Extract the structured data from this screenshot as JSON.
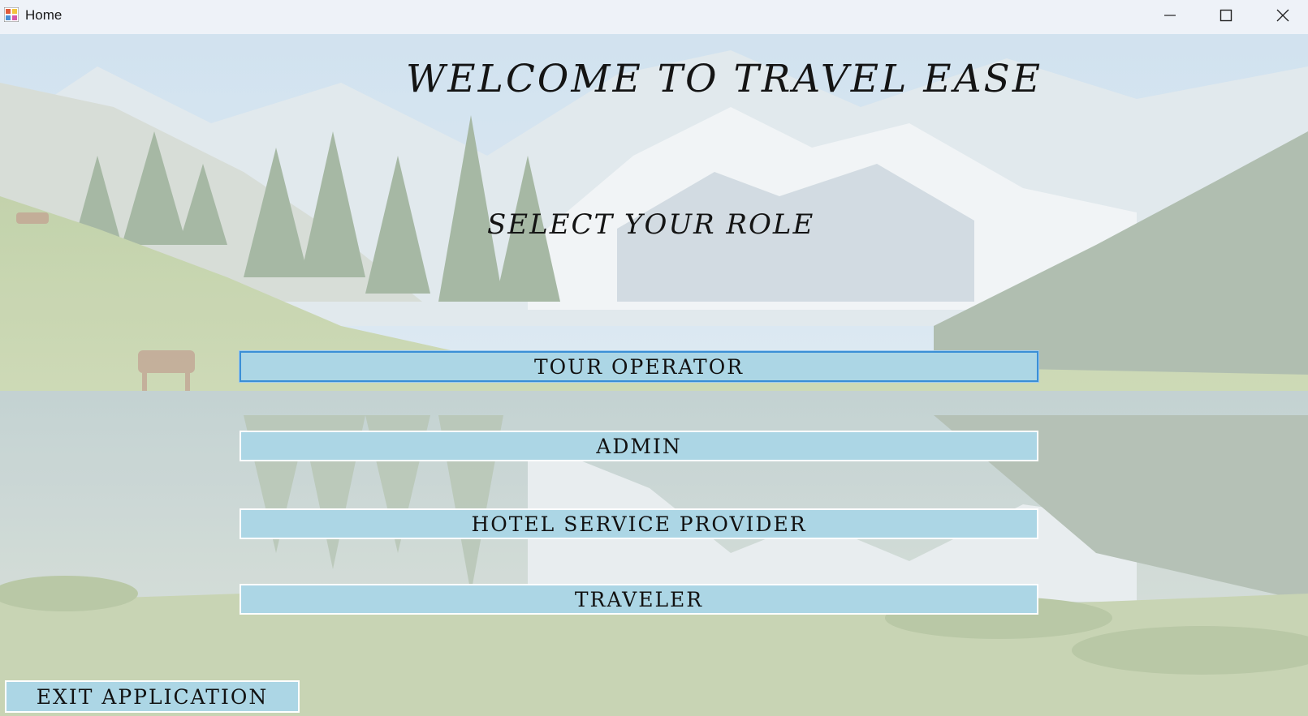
{
  "window": {
    "title": "Home"
  },
  "header": {
    "welcome": "WELCOME TO TRAVEL EASE",
    "subtitle": "SELECT YOUR ROLE"
  },
  "roles": [
    {
      "label": "TOUR OPERATOR"
    },
    {
      "label": "ADMIN"
    },
    {
      "label": "HOTEL SERVICE PROVIDER"
    },
    {
      "label": "TRAVELER"
    }
  ],
  "footer": {
    "exit_label": "EXIT APPLICATION"
  },
  "colors": {
    "button_fill": "#acd6e5",
    "focus_border": "#3b8fd6"
  },
  "icons": {
    "app": "app-icon",
    "minimize": "minimize-icon",
    "maximize": "maximize-icon",
    "close": "close-icon"
  }
}
